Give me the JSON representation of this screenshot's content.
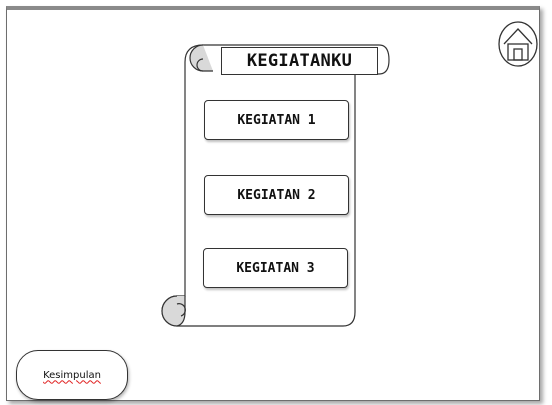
{
  "scroll": {
    "title": "KEGIATANKU"
  },
  "menu": {
    "items": [
      {
        "label": "KEGIATAN 1"
      },
      {
        "label": "KEGIATAN 2"
      },
      {
        "label": "KEGIATAN 3"
      }
    ]
  },
  "footer": {
    "conclusion_label": "Kesimpulan"
  },
  "icons": {
    "home": "home-icon"
  }
}
